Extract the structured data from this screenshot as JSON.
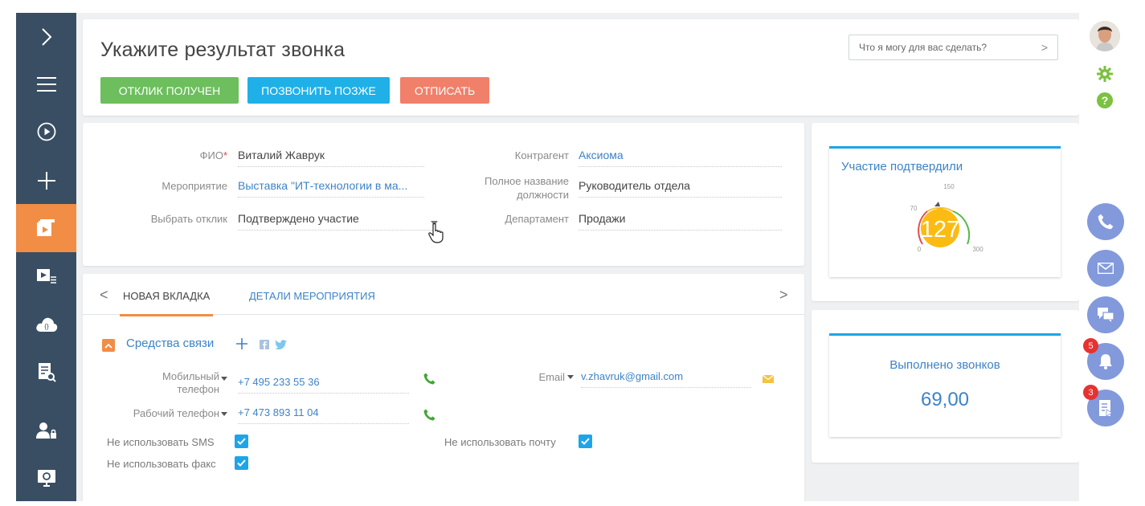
{
  "header": {
    "title": "Укажите результат звонка",
    "buttons": [
      "ОТКЛИК ПОЛУЧЕН",
      "ПОЗВОНИТЬ ПОЗЖЕ",
      "ОТПИСАТЬ"
    ],
    "search_placeholder": "Что я могу для вас сделать?"
  },
  "form": {
    "fio_label": "ФИО",
    "fio_value": "Виталий Жаврук",
    "event_label": "Мероприятие",
    "event_value": "Выставка \"ИТ-технологии в ма...",
    "response_label": "Выбрать отклик",
    "response_value": "Подтверждено участие",
    "account_label": "Контрагент",
    "account_value": "Аксиома",
    "jobtitle_label_1": "Полное название",
    "jobtitle_label_2": "должности",
    "jobtitle_value": "Руководитель отдела",
    "department_label": "Департамент",
    "department_value": "Продажи"
  },
  "tabs": {
    "items": [
      "НОВАЯ ВКЛАДКА",
      "ДЕТАЛИ МЕРОПРИЯТИЯ"
    ],
    "group_title": "Средства связи",
    "mobile_label_1": "Мобильный",
    "mobile_label_2": "телефон",
    "mobile_value": "+7 495 233 55 36",
    "work_label": "Рабочий телефон",
    "work_value": "+7 473 893 11 04",
    "email_label": "Email",
    "email_value": "v.zhavruk@gmail.com",
    "no_sms": "Не использовать SMS",
    "no_fax": "Не использовать факс",
    "no_mail": "Не использовать почту"
  },
  "dashboard": {
    "widget1_title": "Участие подтвердили",
    "gauge_value": "127",
    "gauge_ticks": [
      "0",
      "70",
      "150",
      "300"
    ],
    "widget2_title": "Выполнено звонков",
    "widget2_value": "69,00"
  },
  "rail": {
    "badges": [
      "5",
      "3"
    ]
  },
  "colors": {
    "nav_bg": "#394e63",
    "accent_orange": "#f18d45",
    "green": "#6cbf5c",
    "blue": "#1fb0e8",
    "red": "#f0806a",
    "link": "#3d83c7"
  }
}
